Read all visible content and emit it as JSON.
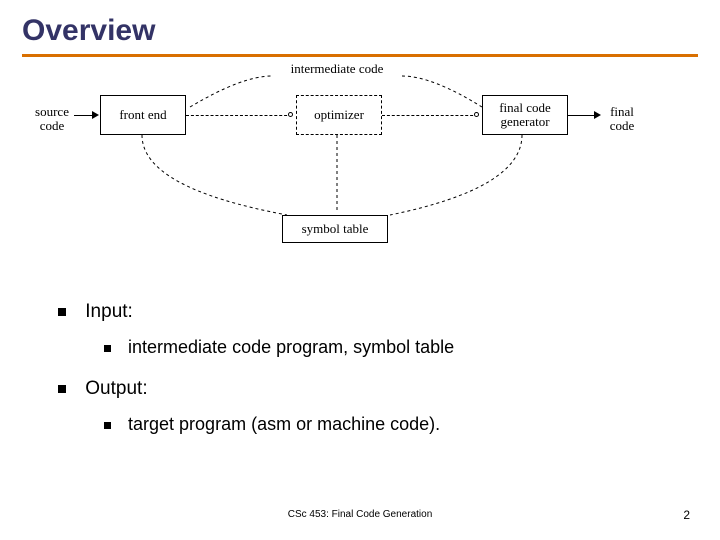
{
  "title": "Overview",
  "diagram": {
    "source_label": "source\ncode",
    "front_end": "front end",
    "intermediate_label": "intermediate code",
    "optimizer": "optimizer",
    "final_gen": "final code\ngenerator",
    "final_label": "final\ncode",
    "symbol_table": "symbol table"
  },
  "bullets": {
    "input_label": "Input:",
    "input_sub": "intermediate code program, symbol table",
    "output_label": "Output:",
    "output_sub": "target program (asm or machine code)."
  },
  "footer": {
    "center": "CSc 453: Final Code Generation",
    "page": "2"
  }
}
